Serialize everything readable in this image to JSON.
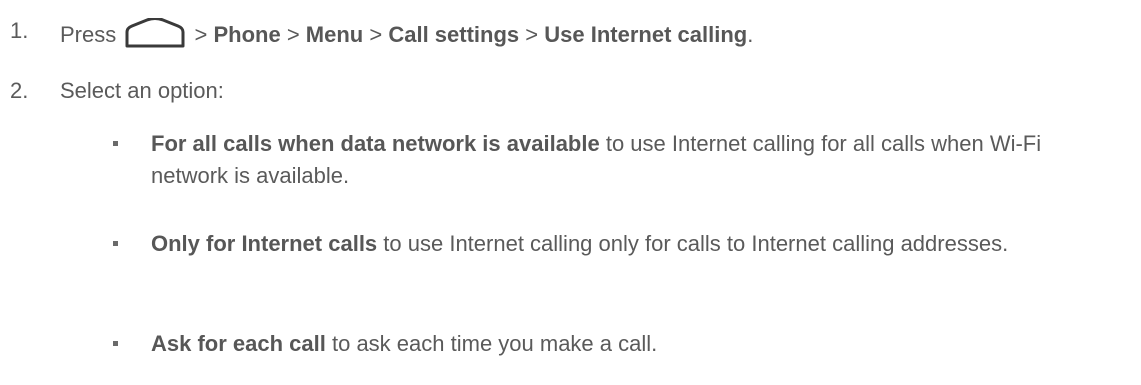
{
  "steps": [
    {
      "number": "1.",
      "press": "Press",
      "icon": "home-icon",
      "sep": ">",
      "path": [
        "Phone",
        "Menu",
        "Call settings",
        "Use Internet calling"
      ],
      "end": "."
    },
    {
      "number": "2.",
      "text": "Select an option:"
    }
  ],
  "options": [
    {
      "bold": "For all calls when data network is available",
      "rest": " to use Internet calling for all calls when Wi-Fi network is available."
    },
    {
      "bold": "Only for Internet calls",
      "rest": " to use Internet calling only for calls to Internet calling addresses."
    },
    {
      "bold": "Ask for each call",
      "rest": " to ask each time you make a call."
    }
  ]
}
